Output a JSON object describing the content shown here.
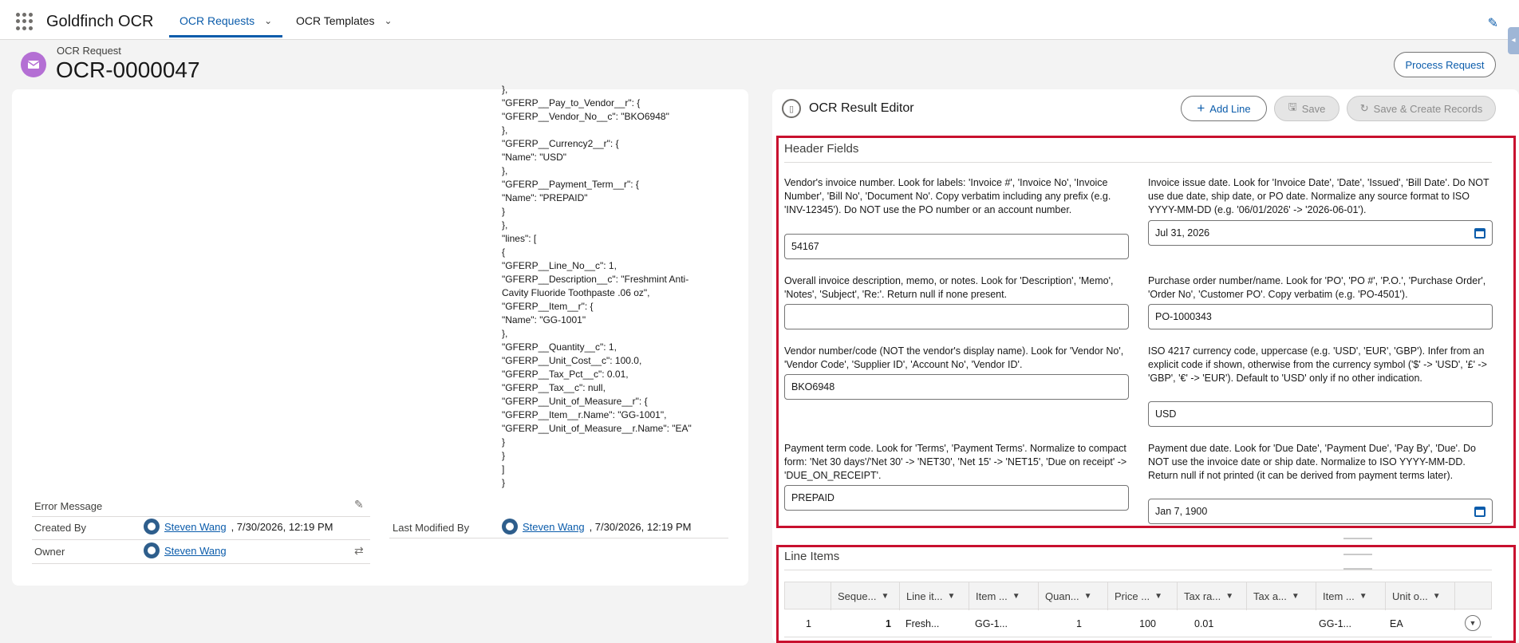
{
  "app": {
    "name": "Goldfinch OCR"
  },
  "nav": {
    "tabs": [
      {
        "label": "OCR Requests"
      },
      {
        "label": "OCR Templates"
      }
    ]
  },
  "record": {
    "type_label": "OCR Request",
    "title": "OCR-0000047"
  },
  "actions": {
    "process_request": "Process Request"
  },
  "json_lines": [
    "},",
    "\"GFERP__Pay_to_Vendor__r\": {",
    "\"GFERP__Vendor_No__c\": \"BKO6948\"",
    "},",
    "\"GFERP__Currency2__r\": {",
    "\"Name\": \"USD\"",
    "},",
    "\"GFERP__Payment_Term__r\": {",
    "\"Name\": \"PREPAID\"",
    "}",
    "},",
    "\"lines\": [",
    "{",
    "\"GFERP__Line_No__c\": 1,",
    "\"GFERP__Description__c\": \"Freshmint Anti-Cavity Fluoride Toothpaste .06 oz\",",
    "\"GFERP__Item__r\": {",
    "\"Name\": \"GG-1001\"",
    "},",
    "\"GFERP__Quantity__c\": 1,",
    "\"GFERP__Unit_Cost__c\": 100.0,",
    "\"GFERP__Tax_Pct__c\": 0.01,",
    "\"GFERP__Tax__c\": null,",
    "\"GFERP__Unit_of_Measure__r\": {",
    "\"GFERP__Item__r.Name\": \"GG-1001\",",
    "\"GFERP__Unit_of_Measure__r.Name\": \"EA\"",
    "}",
    "}",
    "]",
    "}"
  ],
  "details": {
    "error_message_label": "Error Message",
    "created_by_label": "Created By",
    "created_by_user": "Steven Wang",
    "created_by_date": ", 7/30/2026, 12:19 PM",
    "last_modified_label": "Last Modified By",
    "last_modified_user": "Steven Wang",
    "last_modified_date": ", 7/30/2026, 12:19 PM",
    "owner_label": "Owner",
    "owner_user": "Steven Wang"
  },
  "editor": {
    "title": "OCR Result Editor",
    "add_line": "Add Line",
    "save": "Save",
    "save_create": "Save & Create Records",
    "header_section": "Header Fields",
    "line_section": "Line Items"
  },
  "header_fields": {
    "invoice_no": {
      "label": "Vendor's invoice number. Look for labels: 'Invoice #', 'Invoice No', 'Invoice Number', 'Bill No', 'Document No'. Copy verbatim including any prefix (e.g. 'INV-12345'). Do NOT use the PO number or an account number.",
      "value": "54167"
    },
    "invoice_date": {
      "label": "Invoice issue date. Look for 'Invoice Date', 'Date', 'Issued', 'Bill Date'. Do NOT use due date, ship date, or PO date. Normalize any source format to ISO YYYY-MM-DD (e.g. '06/01/2026' -> '2026-06-01').",
      "value": "Jul 31, 2026"
    },
    "description": {
      "label": "Overall invoice description, memo, or notes. Look for 'Description', 'Memo', 'Notes', 'Subject', 'Re:'. Return null if none present.",
      "value": ""
    },
    "po": {
      "label": "Purchase order number/name. Look for 'PO', 'PO #', 'P.O.', 'Purchase Order', 'Order No', 'Customer PO'. Copy verbatim (e.g. 'PO-4501').",
      "value": "PO-1000343"
    },
    "vendor_no": {
      "label": "Vendor number/code (NOT the vendor's display name). Look for 'Vendor No', 'Vendor Code', 'Supplier ID', 'Account No', 'Vendor ID'.",
      "value": "BKO6948"
    },
    "currency": {
      "label": "ISO 4217 currency code, uppercase (e.g. 'USD', 'EUR', 'GBP'). Infer from an explicit code if shown, otherwise from the currency symbol ('$' -> 'USD', '£' -> 'GBP', '€' -> 'EUR'). Default to 'USD' only if no other indication.",
      "value": "USD"
    },
    "payment_term": {
      "label": "Payment term code. Look for 'Terms', 'Payment Terms'. Normalize to compact form: 'Net 30 days'/'Net 30' -> 'NET30', 'Net 15' -> 'NET15', 'Due on receipt' -> 'DUE_ON_RECEIPT'.",
      "value": "PREPAID"
    },
    "due_date": {
      "label": "Payment due date. Look for 'Due Date', 'Payment Due', 'Pay By', 'Due'. Do NOT use the invoice date or ship date. Normalize to ISO YYYY-MM-DD. Return null if not printed (it can be derived from payment terms later).",
      "value": "Jan 7, 1900"
    }
  },
  "line_items": {
    "columns": [
      "Seque...",
      "Line it...",
      "Item ...",
      "Quan...",
      "Price ...",
      "Tax ra...",
      "Tax a...",
      "Item ...",
      "Unit o..."
    ],
    "rows": [
      {
        "row_num": "1",
        "sequence": "1",
        "line_item": "Fresh...",
        "item": "GG-1...",
        "quantity": "1",
        "price": "100",
        "tax_rate": "0.01",
        "tax_amount": "",
        "item2": "GG-1...",
        "uom": "EA"
      }
    ]
  },
  "colors": {
    "brand": "#0b5cab",
    "highlight": "#c8102e",
    "record_icon": "#b46fd4"
  }
}
